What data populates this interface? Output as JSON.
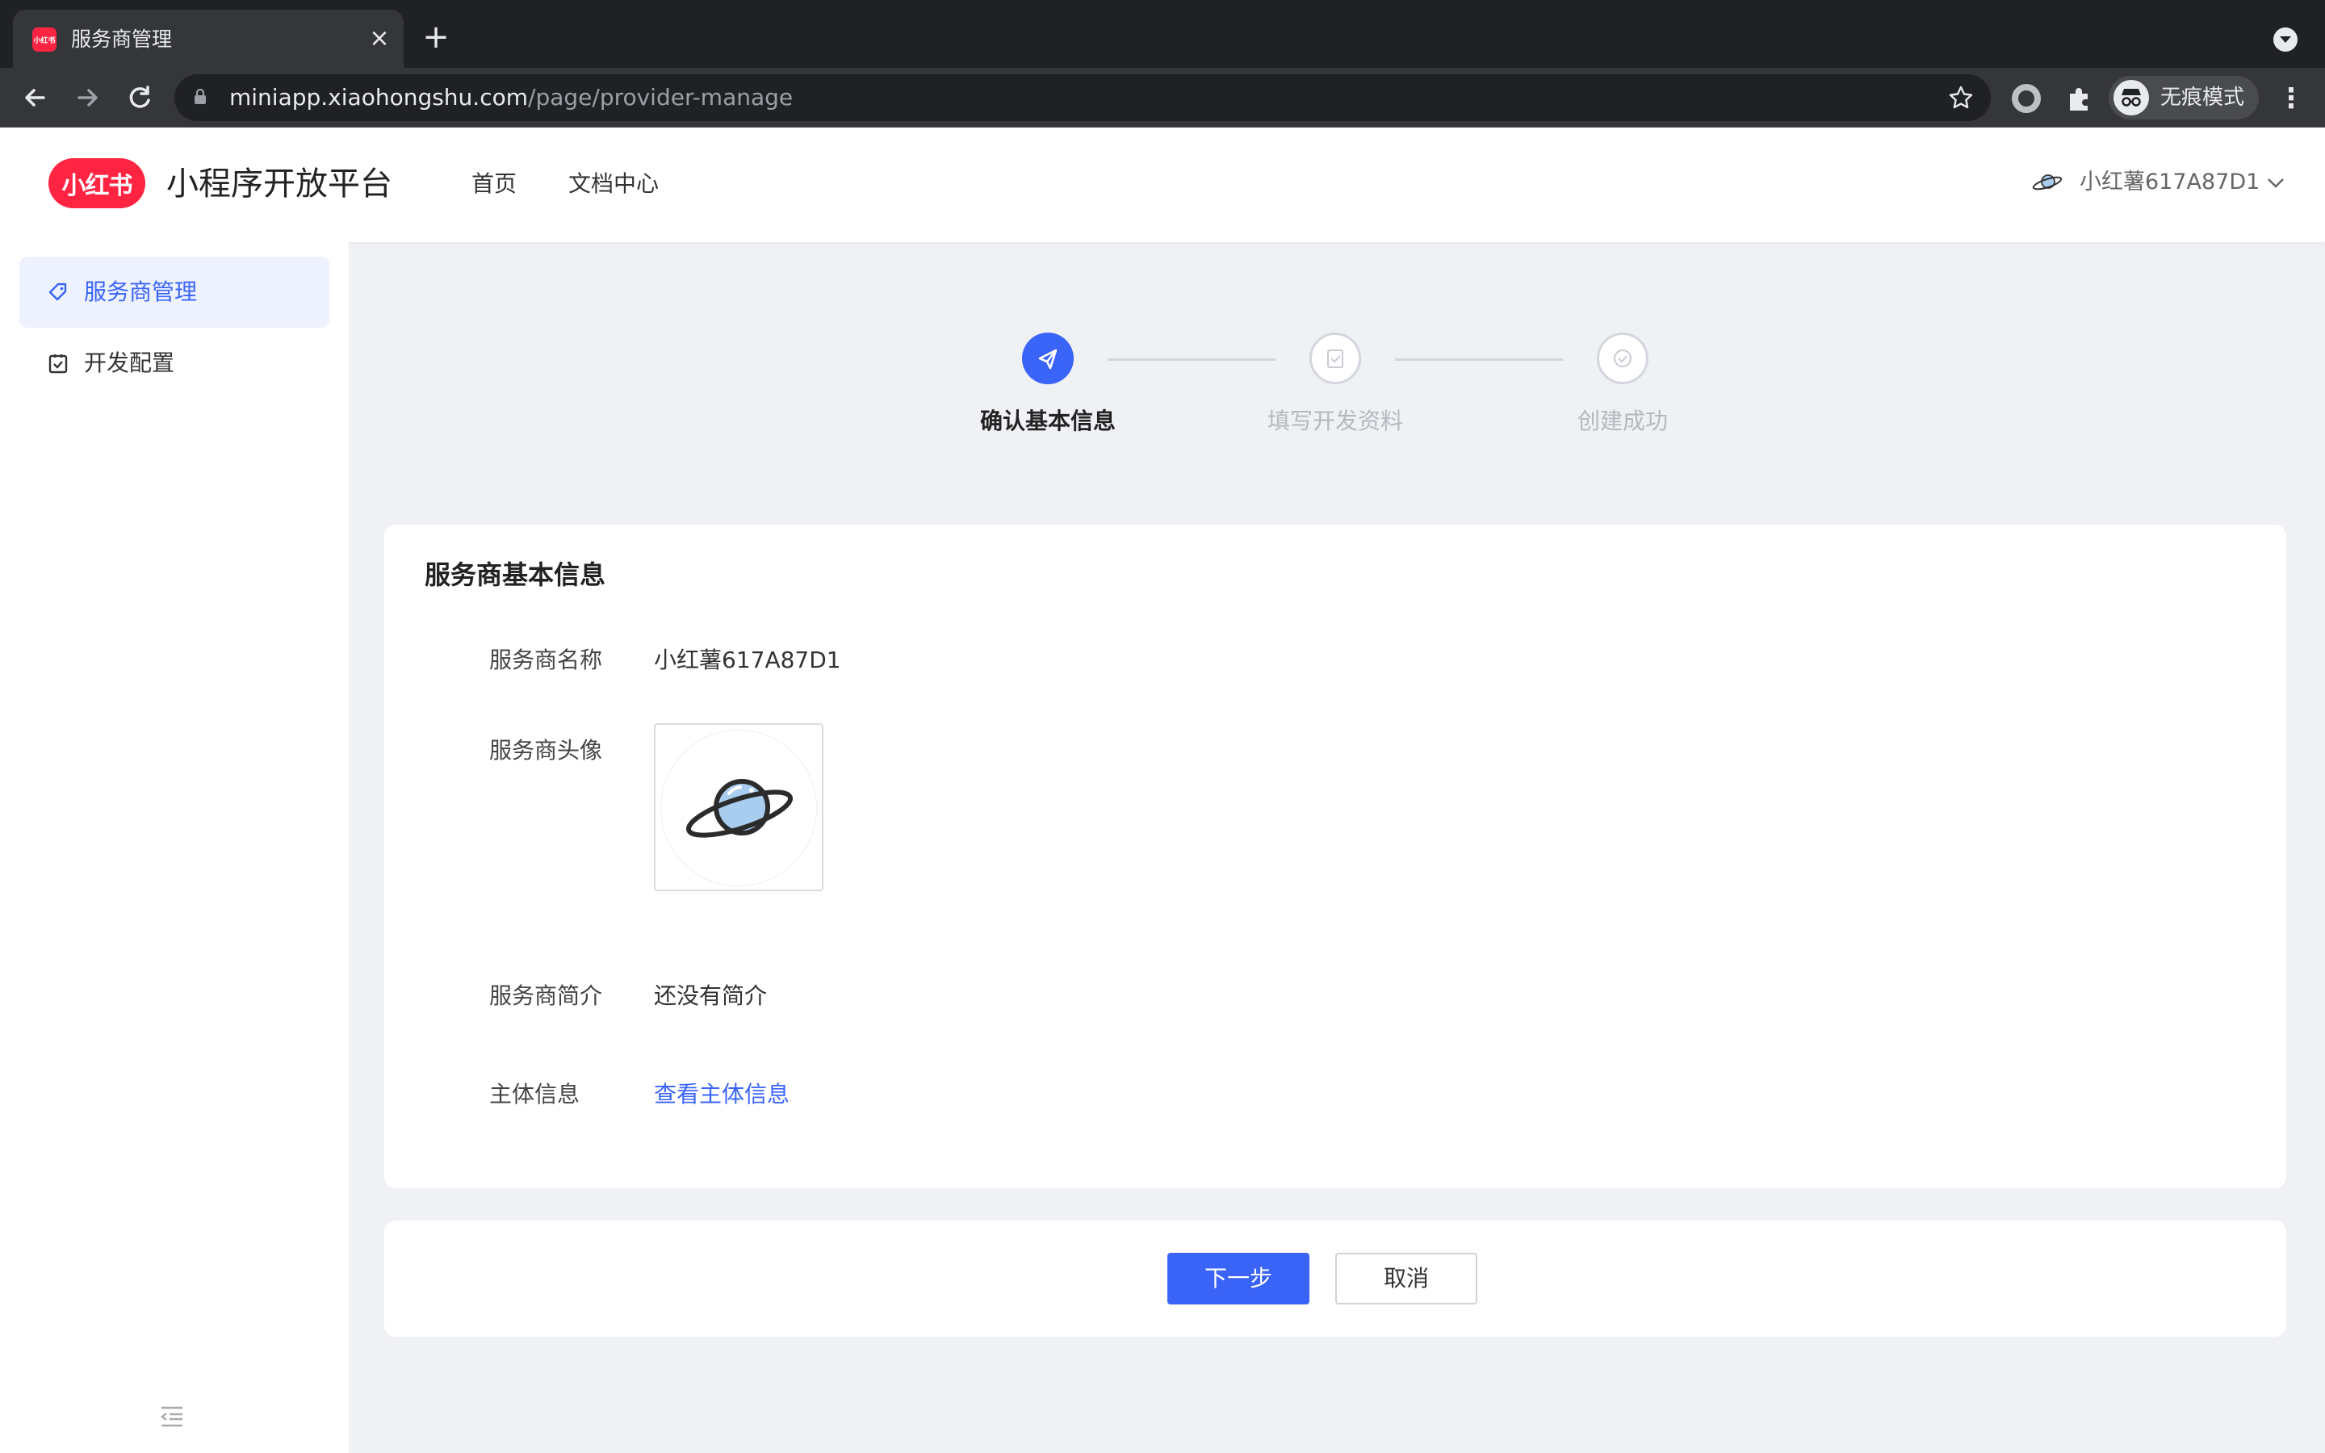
{
  "browser": {
    "tab_title": "服务商管理",
    "favicon_text": "小红书",
    "url_host": "miniapp.xiaohongshu.com",
    "url_path": "/page/provider-manage",
    "incognito_label": "无痕模式"
  },
  "header": {
    "logo_text": "小红书",
    "platform_title": "小程序开放平台",
    "nav": [
      "首页",
      "文档中心"
    ],
    "user_name": "小红薯617A87D1"
  },
  "sidebar": {
    "items": [
      {
        "label": "服务商管理",
        "icon": "tag-icon",
        "active": true
      },
      {
        "label": "开发配置",
        "icon": "clipboard-check-icon",
        "active": false
      }
    ]
  },
  "steps": [
    {
      "label": "确认基本信息",
      "icon": "send-icon",
      "status": "active"
    },
    {
      "label": "填写开发资料",
      "icon": "clipboard-check-icon",
      "status": "pending"
    },
    {
      "label": "创建成功",
      "icon": "check-circle-icon",
      "status": "pending"
    }
  ],
  "info_card": {
    "title": "服务商基本信息",
    "fields": [
      {
        "label": "服务商名称",
        "value": "小红薯617A87D1"
      },
      {
        "label": "服务商头像",
        "value": ""
      },
      {
        "label": "服务商简介",
        "value": "还没有简介"
      },
      {
        "label": "主体信息",
        "value": "查看主体信息"
      }
    ]
  },
  "actions": {
    "next_label": "下一步",
    "cancel_label": "取消"
  },
  "colors": {
    "accent": "#3a64f8",
    "brand": "#ff2442"
  }
}
